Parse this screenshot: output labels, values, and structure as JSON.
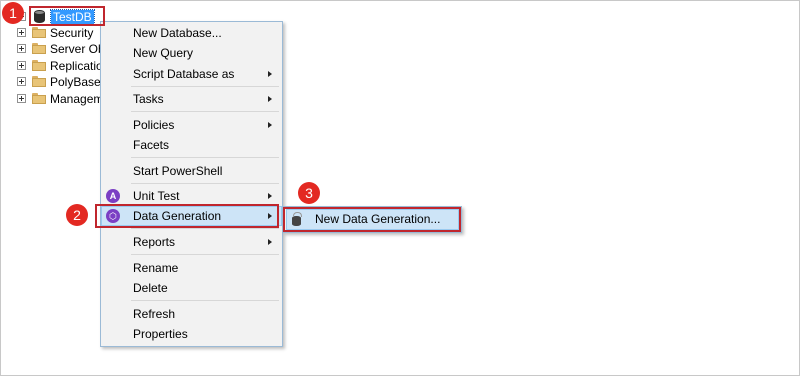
{
  "tree": {
    "selected_db": "TestDB",
    "items": [
      {
        "label": "Security",
        "icon": "folder-icon"
      },
      {
        "label": "Server Obj",
        "icon": "folder-icon"
      },
      {
        "label": "Replication",
        "icon": "folder-icon"
      },
      {
        "label": "PolyBase",
        "icon": "folder-icon"
      },
      {
        "label": "Managem",
        "icon": "folder-icon"
      }
    ]
  },
  "context_menu": {
    "items": [
      {
        "label": "New Database..."
      },
      {
        "label": "New Query"
      },
      {
        "label": "Script Database as",
        "submenu": true
      },
      {
        "label": "Tasks",
        "submenu": true
      },
      {
        "label": "Policies",
        "submenu": true
      },
      {
        "label": "Facets"
      },
      {
        "label": "Start PowerShell"
      },
      {
        "label": "Unit Test",
        "submenu": true,
        "icon": "unit-test-icon"
      },
      {
        "label": "Data Generation",
        "submenu": true,
        "icon": "data-generation-icon",
        "highlighted": true
      },
      {
        "label": "Reports",
        "submenu": true
      },
      {
        "label": "Rename"
      },
      {
        "label": "Delete"
      },
      {
        "label": "Refresh"
      },
      {
        "label": "Properties"
      }
    ]
  },
  "submenu": {
    "item": "New Data Generation..."
  },
  "callouts": [
    "1",
    "2",
    "3"
  ],
  "colors": {
    "selection": "#3399ff",
    "menu_highlight": "#cde4f7",
    "annotation_red": "#c0262d",
    "callout_red": "#e32922"
  }
}
